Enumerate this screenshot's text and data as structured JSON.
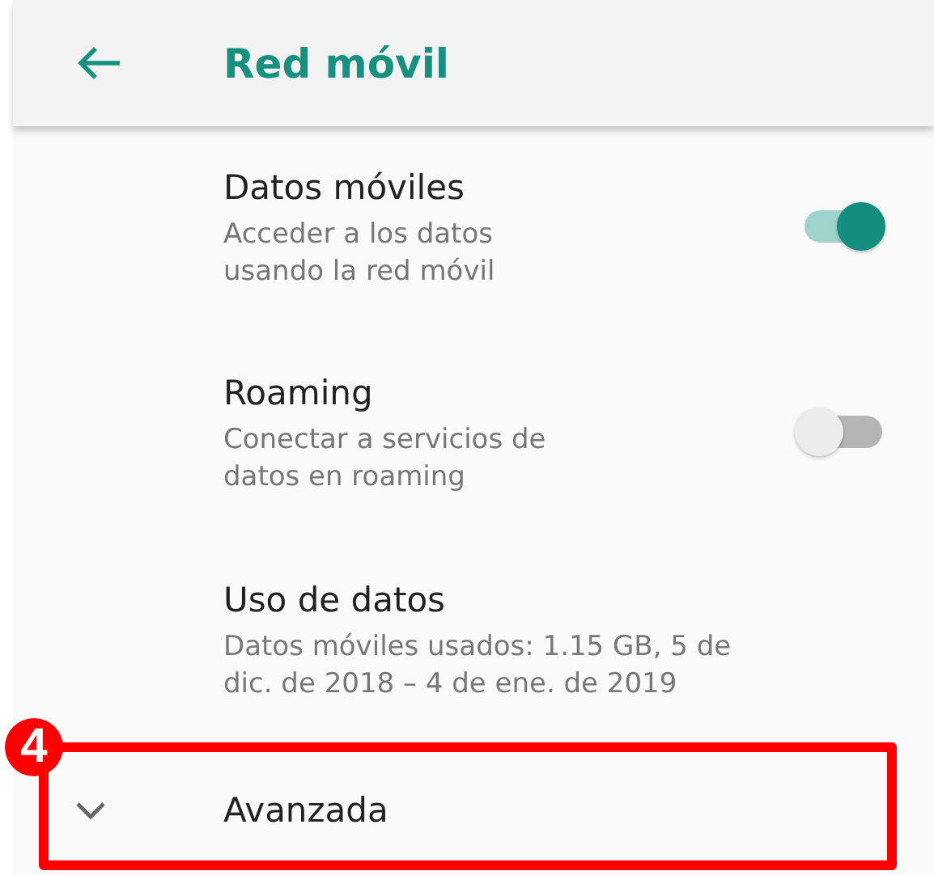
{
  "app_bar": {
    "title": "Red móvil"
  },
  "items": [
    {
      "kind": "switch",
      "title": "Datos móviles",
      "summary": "Acceder a los datos\nusando la red móvil",
      "on": true
    },
    {
      "kind": "switch",
      "title": "Roaming",
      "summary": "Conectar a servicios de\ndatos en roaming",
      "on": false
    },
    {
      "kind": "plain",
      "title": "Uso de datos",
      "summary": "Datos móviles usados: 1.15 GB, 5 de\ndic. de 2018 – 4 de ene. de 2019"
    },
    {
      "kind": "expand",
      "title": "Avanzada",
      "expanded": false
    }
  ],
  "annotation": {
    "label": "4"
  }
}
